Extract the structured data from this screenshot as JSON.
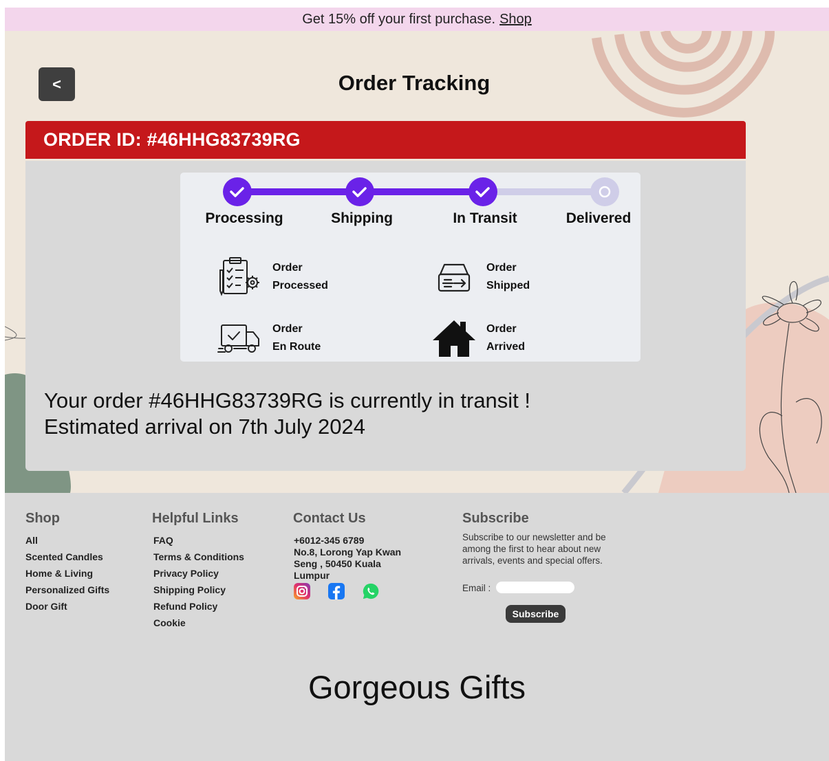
{
  "promo": {
    "text": "Get 15% off your first purchase.",
    "link": "Shop"
  },
  "header": {
    "back_label": "<",
    "title": "Order Tracking"
  },
  "order": {
    "id_label": "ORDER ID:  #46HHG83739RG",
    "steps": [
      {
        "label": "Processing",
        "state": "done"
      },
      {
        "label": "Shipping",
        "state": "done"
      },
      {
        "label": "In Transit",
        "state": "done"
      },
      {
        "label": "Delivered",
        "state": "pending"
      }
    ],
    "statuses": [
      {
        "line1": "Order",
        "line2": "Processed",
        "icon": "clipboard-gear-icon"
      },
      {
        "line1": "Order",
        "line2": "Shipped",
        "icon": "box-arrow-icon"
      },
      {
        "line1": "Order",
        "line2": "En Route",
        "icon": "delivery-truck-icon"
      },
      {
        "line1": "Order",
        "line2": "Arrived",
        "icon": "house-icon"
      }
    ],
    "message_line1": "Your order #46HHG83739RG  is currently in transit !",
    "message_line2": "Estimated arrival on 7th July 2024",
    "colors": {
      "accent": "#6a22e8",
      "track_pending": "#cfcde8",
      "header": "#c5181b"
    }
  },
  "footer": {
    "shop": {
      "title": "Shop",
      "links": [
        "All",
        "Scented Candles",
        "Home & Living",
        "Personalized Gifts",
        "Door Gift"
      ]
    },
    "helpful": {
      "title": "Helpful Links",
      "links": [
        "FAQ",
        "Terms & Conditions",
        "Privacy Policy",
        "Shipping Policy",
        "Refund Policy",
        "Cookie"
      ]
    },
    "contact": {
      "title": "Contact Us",
      "phone": "+6012-345 6789",
      "address": "No.8, Lorong Yap Kwan Seng , 50450 Kuala Lumpur",
      "socials": [
        "instagram-icon",
        "facebook-icon",
        "whatsapp-icon"
      ]
    },
    "subscribe": {
      "title": "Subscribe",
      "text": "Subscribe to our newsletter and be among the first to hear about new arrivals, events and special offers.",
      "email_label": "Email :",
      "email_placeholder": "",
      "button": "Subscribe"
    },
    "brand": "Gorgeous Gifts"
  }
}
